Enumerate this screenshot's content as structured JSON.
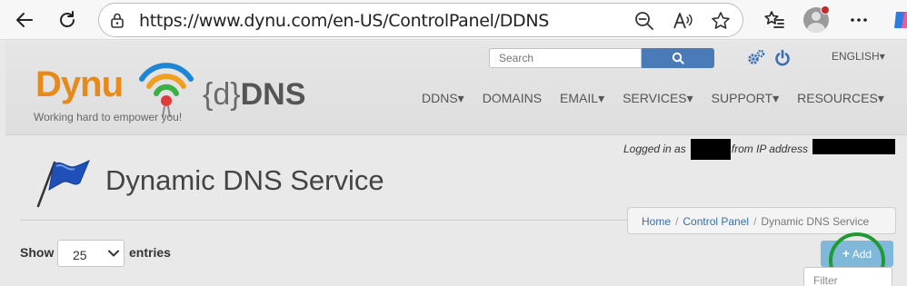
{
  "browser": {
    "url": "https://www.dynu.com/en-US/ControlPanel/DDNS",
    "icons": [
      "back-arrow-icon",
      "refresh-icon",
      "lock-icon",
      "zoom-out-icon",
      "read-aloud-icon",
      "favorite-star-icon",
      "favorites-list-icon",
      "profile-avatar",
      "more-icon"
    ]
  },
  "header": {
    "logo_text": "Dynu",
    "tagline": "Working hard to empower you!",
    "product_prefix": "{d}",
    "product_suffix": "DNS",
    "search_placeholder": "Search",
    "language": "ENGLISH",
    "nav": [
      "DDNS",
      "DOMAINS",
      "EMAIL",
      "SERVICES",
      "SUPPORT",
      "RESOURCES"
    ]
  },
  "session": {
    "logged_in_prefix": "Logged in as",
    "from_ip_text": "from IP address"
  },
  "main": {
    "title": "Dynamic DNS Service",
    "breadcrumb": {
      "home": "Home",
      "control_panel": "Control Panel",
      "current": "Dynamic DNS Service"
    },
    "show_label": "Show",
    "entries_value": "25",
    "entries_label": "entries",
    "add_label": "Add",
    "filter_placeholder": "Filter"
  },
  "colors": {
    "accent_blue": "#4a7ab7",
    "brand_orange": "#e88a1a",
    "add_button": "#7fb8d8",
    "highlight_circle": "#1e9b33"
  }
}
